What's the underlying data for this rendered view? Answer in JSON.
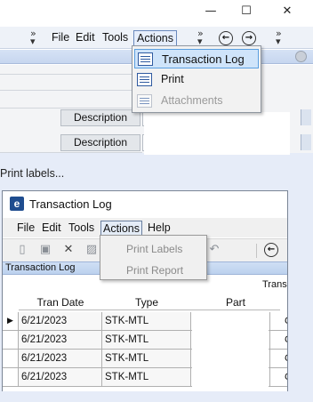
{
  "top_window": {
    "caption": {
      "minimize": "—",
      "maximize": "☐",
      "close": "✕"
    },
    "menu": [
      "File",
      "Edit",
      "Tools",
      "Actions"
    ],
    "active_menu": "Actions",
    "actions_menu": [
      {
        "label": "Transaction Log",
        "highlighted": true,
        "enabled": true,
        "icon": "report-icon"
      },
      {
        "label": "Print",
        "highlighted": false,
        "enabled": true,
        "icon": "print-icon"
      },
      {
        "label": "Attachments",
        "highlighted": false,
        "enabled": false,
        "icon": "attachment-icon"
      }
    ],
    "fields": [
      {
        "button": "Description"
      },
      {
        "button": "Description"
      }
    ]
  },
  "note": "Print labels...",
  "bottom_window": {
    "title": "Transaction Log",
    "menu": [
      "File",
      "Edit",
      "Tools",
      "Actions",
      "Help"
    ],
    "active_menu": "Actions",
    "actions_menu": [
      {
        "label": "Print Labels",
        "enabled": false
      },
      {
        "label": "Print Report",
        "enabled": false
      }
    ],
    "panel_title": "Transaction Log",
    "grid": {
      "group_header": "Trans",
      "columns": [
        "Tran Date",
        "Type",
        "Part"
      ],
      "rows": [
        {
          "date": "6/21/2023",
          "type": "STK-MTL",
          "part": "",
          "trail": "C"
        },
        {
          "date": "6/21/2023",
          "type": "STK-MTL",
          "part": "",
          "trail": "C"
        },
        {
          "date": "6/21/2023",
          "type": "STK-MTL",
          "part": "",
          "trail": "C"
        },
        {
          "date": "6/21/2023",
          "type": "STK-MTL",
          "part": "",
          "trail": "C"
        }
      ]
    }
  }
}
